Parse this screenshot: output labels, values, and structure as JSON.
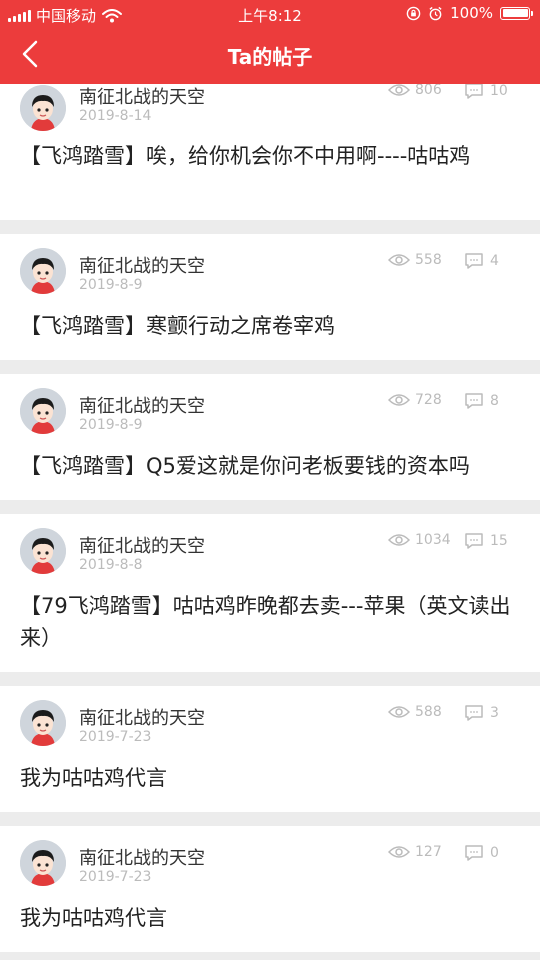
{
  "status_bar": {
    "carrier": "中国移动",
    "time": "上午8:12",
    "battery": "100%"
  },
  "nav": {
    "title": "Ta的帖子"
  },
  "colors": {
    "header": "#ec3c3c",
    "muted": "#bbbbbb"
  },
  "posts": [
    {
      "author": "南征北战的天空",
      "date": "2019-8-14",
      "views": "806",
      "comments": "10",
      "text": "【飞鸿踏雪】唉，给你机会你不中用啊----咕咕鸡"
    },
    {
      "author": "南征北战的天空",
      "date": "2019-8-9",
      "views": "558",
      "comments": "4",
      "text": "【飞鸿踏雪】寒颤行动之席卷宰鸡"
    },
    {
      "author": "南征北战的天空",
      "date": "2019-8-9",
      "views": "728",
      "comments": "8",
      "text": "【飞鸿踏雪】Q5爱这就是你问老板要钱的资本吗"
    },
    {
      "author": "南征北战的天空",
      "date": "2019-8-8",
      "views": "1034",
      "comments": "15",
      "text": "【79飞鸿踏雪】咕咕鸡昨晚都去卖---苹果（英文读出来）"
    },
    {
      "author": "南征北战的天空",
      "date": "2019-7-23",
      "views": "588",
      "comments": "3",
      "text": "我为咕咕鸡代言"
    },
    {
      "author": "南征北战的天空",
      "date": "2019-7-23",
      "views": "127",
      "comments": "0",
      "text": "我为咕咕鸡代言"
    }
  ]
}
